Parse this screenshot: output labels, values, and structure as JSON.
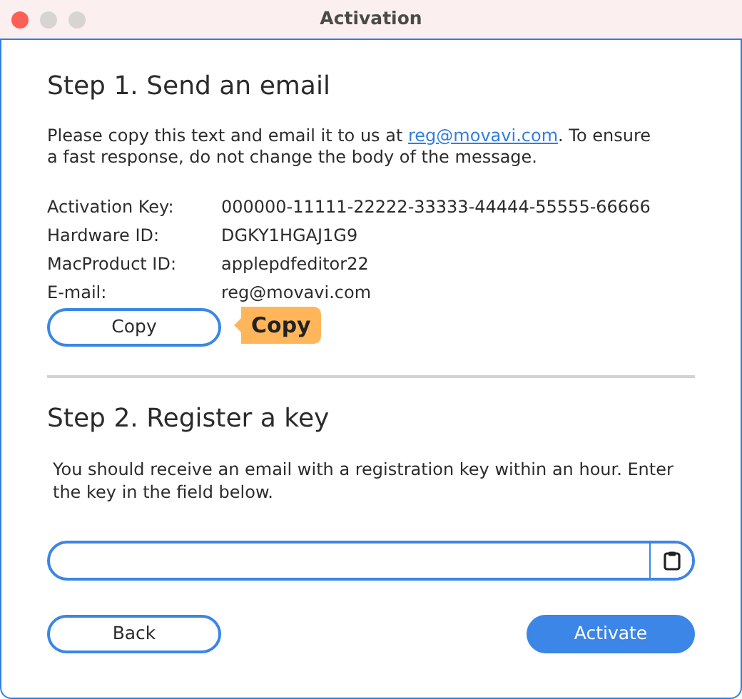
{
  "window": {
    "title": "Activation",
    "controls": [
      {
        "kind": "close"
      },
      {
        "kind": "minimize"
      },
      {
        "kind": "zoom"
      }
    ]
  },
  "step1": {
    "heading": "Step 1. Send an email",
    "instructions": "Please copy this text and email it to us at ",
    "link": "reg@movavi.com",
    "instructions_end": ". To ensure a fast response, do not change the body of the message.",
    "rows": [
      {
        "label": "Activation Key:",
        "value": "000000-11111-22222-33333-44444-55555-66666"
      },
      {
        "label": "Hardware ID:",
        "value": "DGKY1HGAJ1G9"
      },
      {
        "label": "MacProduct ID:",
        "value": "applepdfeditor22"
      },
      {
        "label": "E-mail:",
        "value": "reg@movavi.com"
      }
    ],
    "copy_button": "Copy",
    "tooltip": "Copy"
  },
  "step2": {
    "heading": "Step 2. Register a key",
    "instructions": "You should receive an email with a registration key within an hour. Enter the key in the field below."
  },
  "buttons": [
    {
      "label": "Back",
      "primary": false
    },
    {
      "label": "Activate",
      "primary": true
    }
  ]
}
